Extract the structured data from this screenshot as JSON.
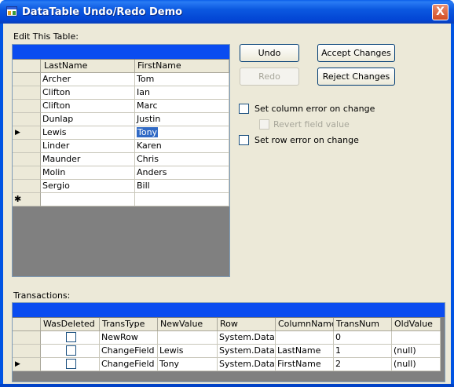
{
  "window": {
    "title": "DataTable Undo/Redo Demo",
    "close_label": "X"
  },
  "edit_table": {
    "label": "Edit This Table:",
    "columns": [
      "LastName",
      "FirstName"
    ],
    "rows": [
      [
        "Archer",
        "Tom"
      ],
      [
        "Clifton",
        "Ian"
      ],
      [
        "Clifton",
        "Marc"
      ],
      [
        "Dunlap",
        "Justin"
      ],
      [
        "Lewis",
        "Tony"
      ],
      [
        "Linder",
        "Karen"
      ],
      [
        "Maunder",
        "Chris"
      ],
      [
        "Molin",
        "Anders"
      ],
      [
        "Sergio",
        "Bill"
      ]
    ],
    "current_row_marker": "▶",
    "new_row_marker": "✱"
  },
  "buttons": {
    "undo": "Undo",
    "redo": "Redo",
    "accept": "Accept Changes",
    "reject": "Reject Changes"
  },
  "options": {
    "column_error": "Set column error on change",
    "revert_field": "Revert field value",
    "row_error": "Set row error on change"
  },
  "transactions": {
    "label": "Transactions:",
    "columns": [
      "WasDeleted",
      "TransType",
      "NewValue",
      "Row",
      "ColumnName",
      "TransNum",
      "OldValue"
    ],
    "rows": [
      [
        "",
        "NewRow",
        "",
        "System.Data.",
        "",
        "0",
        ""
      ],
      [
        "",
        "ChangeField",
        "Lewis",
        "System.Data.",
        "LastName",
        "1",
        "(null)"
      ],
      [
        "",
        "ChangeField",
        "Tony",
        "System.Data.",
        "FirstName",
        "2",
        "(null)"
      ]
    ],
    "current_row_marker": "▶"
  },
  "colors": {
    "titlebar": "#0054e3",
    "grid_caption": "#0a4cf0",
    "selection": "#316ac5",
    "dialog_bg": "#ece9d8"
  }
}
